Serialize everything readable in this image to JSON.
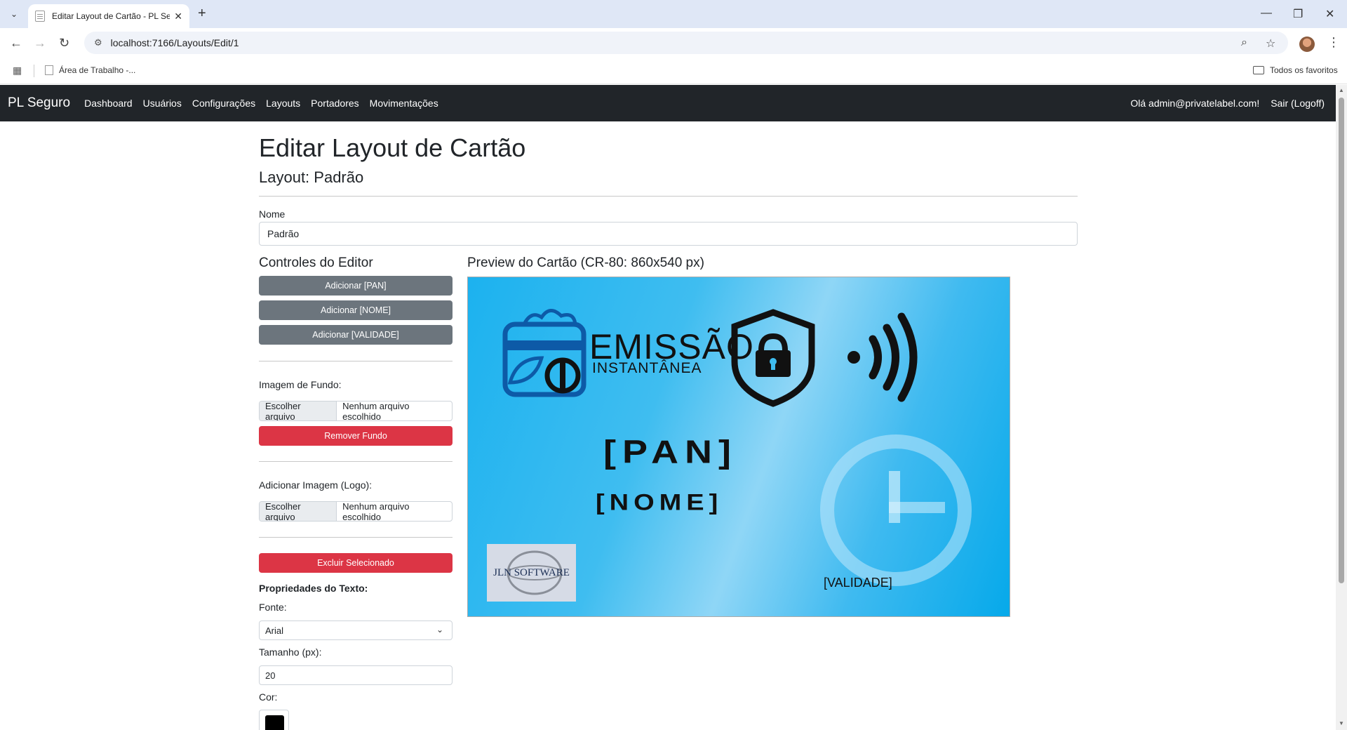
{
  "browser": {
    "tab_title": "Editar Layout de Cartão - PL Se",
    "url": "localhost:7166/Layouts/Edit/1",
    "bookmark_item": "Área de Trabalho -...",
    "bookmark_all": "Todos os favoritos"
  },
  "navbar": {
    "brand": "PL Seguro",
    "links": [
      "Dashboard",
      "Usuários",
      "Configurações",
      "Layouts",
      "Portadores",
      "Movimentações"
    ],
    "greeting": "Olá admin@privatelabel.com!",
    "logout": "Sair (Logoff)"
  },
  "page": {
    "title": "Editar Layout de Cartão",
    "subtitle": "Layout: Padrão",
    "name_label": "Nome",
    "name_value": "Padrão"
  },
  "editor": {
    "title": "Controles do Editor",
    "add_pan": "Adicionar [PAN]",
    "add_nome": "Adicionar [NOME]",
    "add_validade": "Adicionar [VALIDADE]",
    "background_label": "Imagem de Fundo:",
    "choose_file": "Escolher arquivo",
    "no_file": "Nenhum arquivo escolhido",
    "remove_background": "Remover Fundo",
    "logo_label": "Adicionar Imagem (Logo):",
    "delete_selected": "Excluir Selecionado",
    "text_props_title": "Propriedades do Texto:",
    "font_label": "Fonte:",
    "font_value": "Arial",
    "size_label": "Tamanho (px):",
    "size_value": "20",
    "color_label": "Cor:",
    "color_value": "#000000"
  },
  "preview": {
    "title": "Preview do Cartão (CR-80: 860x540 px)",
    "emissao": "EMISSÃO",
    "instantanea": "INSTANTÂNEA",
    "pan": "[PAN]",
    "nome": "[NOME]",
    "validade": "[VALIDADE]",
    "jln_logo": "JLN SOFTWARE"
  },
  "colors": {
    "navbar_bg": "#212529",
    "btn_gray": "#6c757d",
    "btn_red": "#dc3545",
    "card_blue": "#1cb2ef"
  }
}
